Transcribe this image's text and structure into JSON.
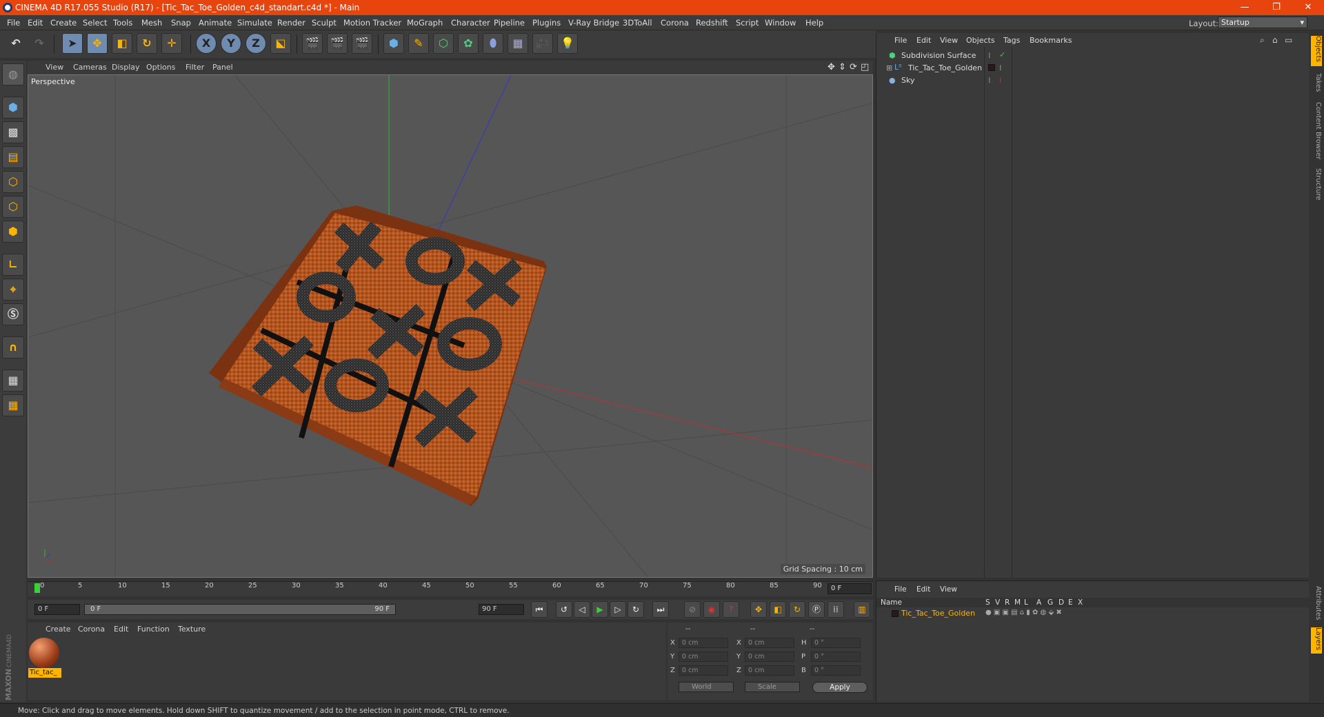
{
  "titlebar": {
    "title": "CINEMA 4D R17.055 Studio (R17) - [Tic_Tac_Toe_Golden_c4d_standart.c4d *] - Main",
    "minimize": "—",
    "maximize": "❐",
    "close": "✕"
  },
  "menubar": {
    "items": [
      "File",
      "Edit",
      "Create",
      "Select",
      "Tools",
      "Mesh",
      "Snap",
      "Animate",
      "Simulate",
      "Render",
      "Sculpt",
      "Motion Tracker",
      "MoGraph",
      "Character",
      "Pipeline",
      "Plugins",
      "V-Ray Bridge",
      "3DToAll",
      "Corona",
      "Redshift",
      "Script",
      "Window",
      "Help"
    ],
    "layout_label": "Layout:",
    "layout_value": "Startup"
  },
  "toolbar": {
    "axis_x": "X",
    "axis_y": "Y",
    "axis_z": "Z"
  },
  "viewport": {
    "menu": [
      "View",
      "Cameras",
      "Display",
      "Options",
      "Filter",
      "Panel"
    ],
    "label": "Perspective",
    "grid_spacing": "Grid Spacing : 10 cm"
  },
  "timeline": {
    "ticks": [
      "0",
      "5",
      "10",
      "15",
      "20",
      "25",
      "30",
      "35",
      "40",
      "45",
      "50",
      "55",
      "60",
      "65",
      "70",
      "75",
      "80",
      "85",
      "90"
    ],
    "current_frame": "0 F"
  },
  "transport": {
    "start_field": "0 F",
    "range_start": "0 F",
    "range_end": "90 F",
    "end_field": "90 F"
  },
  "material_panel": {
    "menu": [
      "Create",
      "Corona",
      "Edit",
      "Function",
      "Texture"
    ],
    "material_name": "Tic_tac_"
  },
  "coord_panel": {
    "headers": [
      "--",
      "--",
      "--"
    ],
    "rows": [
      {
        "l1": "X",
        "v1": "0 cm",
        "l2": "X",
        "v2": "0 cm",
        "l3": "H",
        "v3": "0 °"
      },
      {
        "l1": "Y",
        "v1": "0 cm",
        "l2": "Y",
        "v2": "0 cm",
        "l3": "P",
        "v3": "0 °"
      },
      {
        "l1": "Z",
        "v1": "0 cm",
        "l2": "Z",
        "v2": "0 cm",
        "l3": "B",
        "v3": "0 °"
      }
    ],
    "space_select": "World",
    "mode_select": "Scale",
    "apply": "Apply"
  },
  "object_manager": {
    "menu": [
      "File",
      "Edit",
      "View",
      "Objects",
      "Tags",
      "Bookmarks"
    ],
    "objects": [
      "Subdivision Surface",
      "Tic_Tac_Toe_Golden",
      "Sky"
    ]
  },
  "layer_manager": {
    "menu": [
      "File",
      "Edit",
      "View"
    ],
    "columns": [
      "Name",
      "S",
      "V",
      "R",
      "M",
      "L",
      "A",
      "G",
      "D",
      "E",
      "X"
    ],
    "layer_name": "Tic_Tac_Toe_Golden"
  },
  "side_tabs": [
    "Objects",
    "Takes",
    "Content Browser",
    "Structure"
  ],
  "side_tabs_bottom": [
    "Attributes",
    "Layers"
  ],
  "status": "Move: Click and drag to move elements. Hold down SHIFT to quantize movement / add to the selection in point mode, CTRL to remove.",
  "colors": {
    "titlebar": "#e8450e",
    "accent": "#ffb400",
    "selected_tool": "#6f8bb0"
  }
}
